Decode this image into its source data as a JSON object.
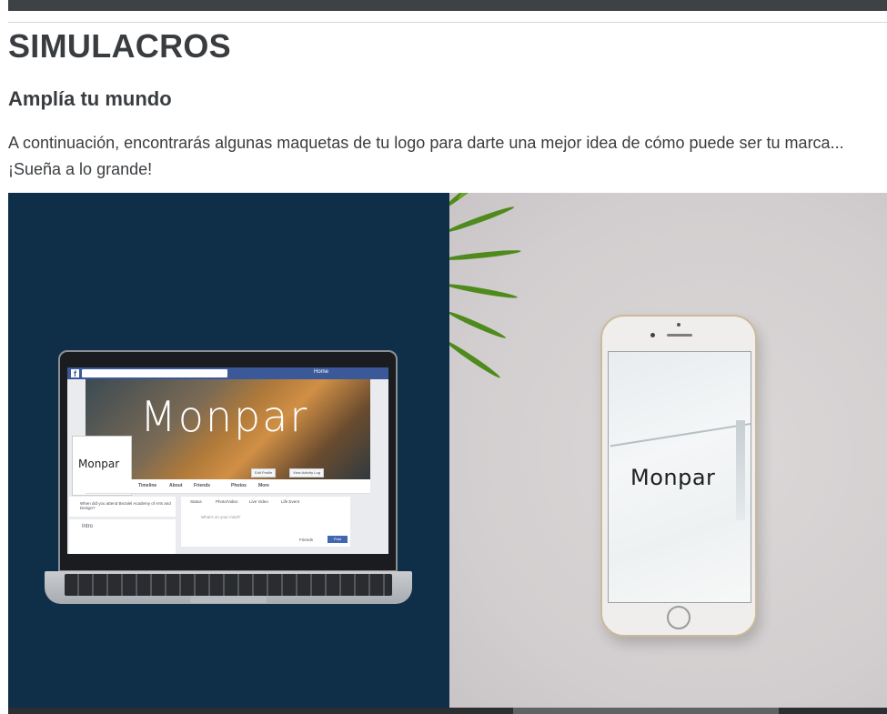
{
  "header": {
    "title": "SIMULACROS",
    "subtitle": "Amplía tu mundo",
    "description": "A continuación, encontrarás algunas maquetas de tu logo para darte una mejor idea de cómo puede ser tu marca... ¡Sueña a lo grande!"
  },
  "mockups": {
    "logo_text": "Monpar",
    "facebook": {
      "brand_icon": "f",
      "home_link": "Home",
      "edit_profile": "Edit Profile",
      "view_activity_log": "View Activity Log",
      "tabs": [
        "Timeline",
        "About",
        "Friends",
        "Photos",
        "More"
      ],
      "prompt": "When did you attend Bezalel Academy of Arts and Design?",
      "intro": "Intro",
      "composer_options": [
        "Status",
        "Photo/Video",
        "Live Video",
        "Life Event"
      ],
      "composer_placeholder": "What's on your mind?",
      "audience": "Friends",
      "post": "Post"
    }
  },
  "colors": {
    "panel_left_bg": "#0f2f49",
    "facebook_blue": "#3b5998",
    "topbar": "#3d4244"
  }
}
